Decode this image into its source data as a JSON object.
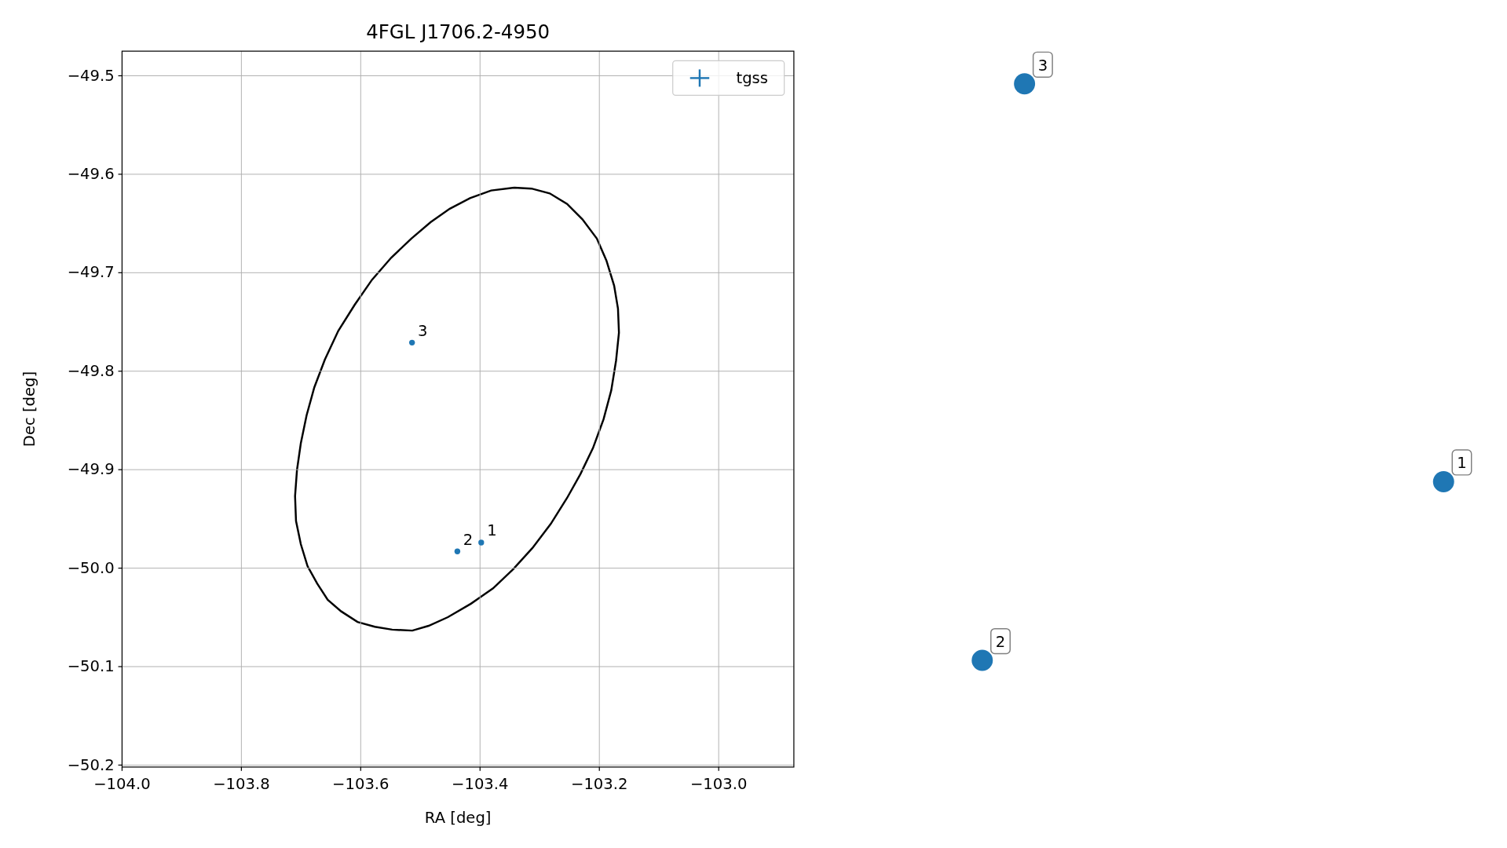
{
  "chart_data": {
    "type": "scatter",
    "title": "4FGL J1706.2-4950",
    "xlabel": "RA [deg]",
    "ylabel": "Dec [deg]",
    "xlim": [
      -104.0,
      -102.874
    ],
    "ylim": [
      -50.202,
      -49.475
    ],
    "grid": true,
    "xticks": [
      {
        "value": -104.0,
        "label": "−104.0"
      },
      {
        "value": -103.8,
        "label": "−103.8"
      },
      {
        "value": -103.6,
        "label": "−103.6"
      },
      {
        "value": -103.4,
        "label": "−103.4"
      },
      {
        "value": -103.2,
        "label": "−103.2"
      },
      {
        "value": -103.0,
        "label": "−103.0"
      }
    ],
    "yticks": [
      {
        "value": -49.5,
        "label": "−49.5"
      },
      {
        "value": -49.6,
        "label": "−49.6"
      },
      {
        "value": -49.7,
        "label": "−49.7"
      },
      {
        "value": -49.8,
        "label": "−49.8"
      },
      {
        "value": -49.9,
        "label": "−49.9"
      },
      {
        "value": -50.0,
        "label": "−50.0"
      },
      {
        "value": -50.1,
        "label": "−50.1"
      },
      {
        "value": -50.2,
        "label": "−50.2"
      }
    ],
    "series": [
      {
        "name": "tgss",
        "color": "#1f77b4",
        "x": [
          -103.398,
          -103.438,
          -103.514
        ],
        "values": [
          -49.974,
          -49.983,
          -49.771
        ]
      }
    ],
    "annotations": [
      {
        "text": "1",
        "x": -103.398,
        "y": -49.974
      },
      {
        "text": "2",
        "x": -103.438,
        "y": -49.983
      },
      {
        "text": "3",
        "x": -103.514,
        "y": -49.771
      },
      "3",
      "1",
      "2"
    ]
  }
}
